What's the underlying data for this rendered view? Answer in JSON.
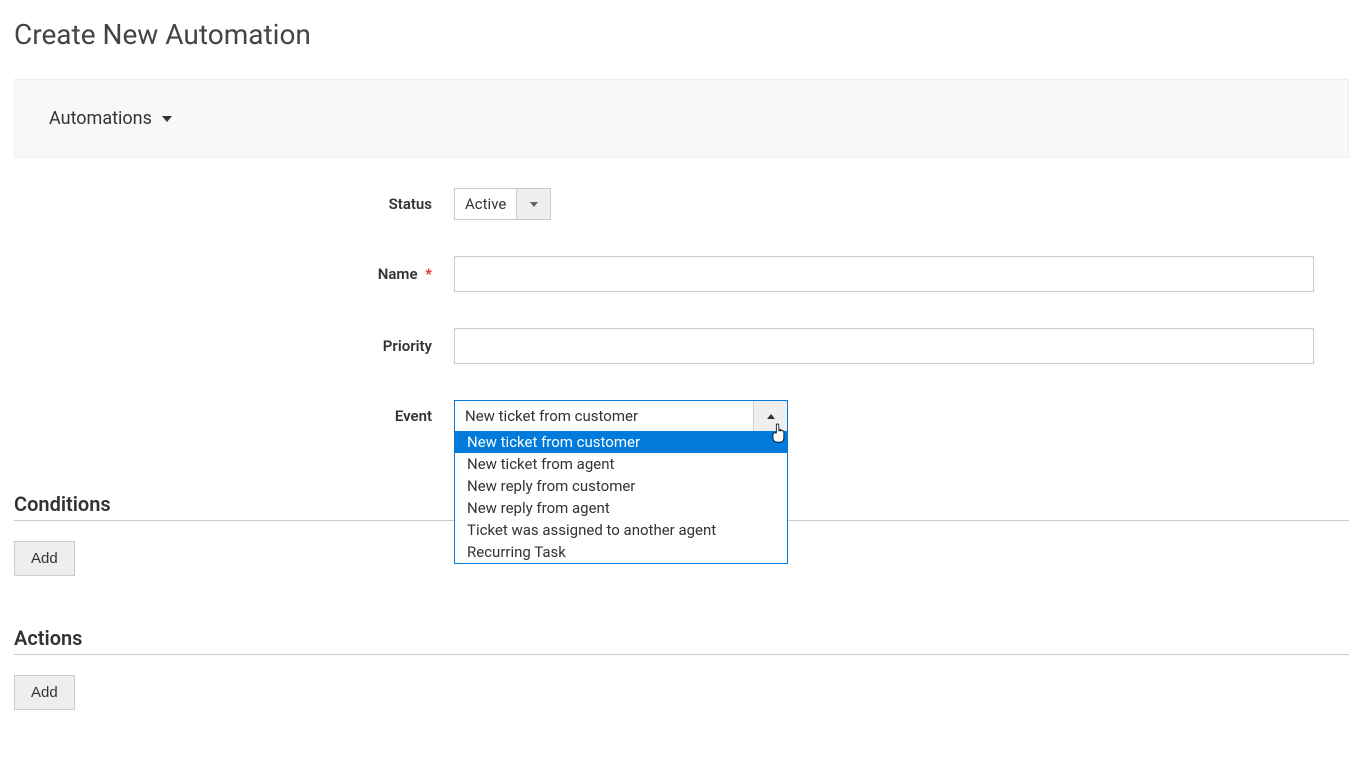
{
  "page_title": "Create New Automation",
  "breadcrumb": {
    "label": "Automations"
  },
  "form": {
    "status": {
      "label": "Status",
      "value": "Active"
    },
    "name": {
      "label": "Name",
      "required_marker": "*",
      "value": ""
    },
    "priority": {
      "label": "Priority",
      "value": ""
    },
    "event": {
      "label": "Event",
      "value": "New ticket from customer",
      "options": [
        "New ticket from customer",
        "New ticket from agent",
        "New reply from customer",
        "New reply from agent",
        "Ticket was assigned to another agent",
        "Recurring Task"
      ]
    }
  },
  "sections": {
    "conditions": {
      "title": "Conditions",
      "add_label": "Add"
    },
    "actions": {
      "title": "Actions",
      "add_label": "Add"
    }
  }
}
